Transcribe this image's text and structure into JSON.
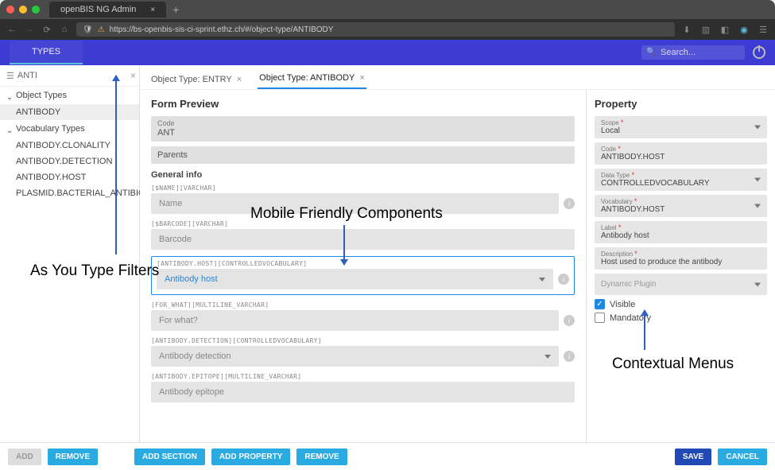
{
  "browser": {
    "tab_title": "openBIS NG Admin",
    "url": "https://bs-openbis-sis-ci-sprint.ethz.ch/#/object-type/ANTIBODY"
  },
  "topbar": {
    "types_label": "TYPES",
    "search_placeholder": "Search..."
  },
  "sidebar": {
    "filter_value": "ANTI",
    "cat_object_types": "Object Types",
    "cat_vocab_types": "Vocabulary Types",
    "items": {
      "antibody": "ANTIBODY",
      "clonality": "ANTIBODY.CLONALITY",
      "detection": "ANTIBODY.DETECTION",
      "host": "ANTIBODY.HOST",
      "plasmid": "PLASMID.BACTERIAL_ANTIBIOTIC_"
    }
  },
  "tabs": {
    "entry": "Object Type: ENTRY",
    "antibody": "Object Type: ANTIBODY"
  },
  "form": {
    "title": "Form Preview",
    "code_label": "Code",
    "code_value": "ANT",
    "parents_label": "Parents",
    "general_info": "General info",
    "meta_name": "[$NAME][VARCHAR]",
    "name_ph": "Name",
    "meta_barcode": "[$BARCODE][VARCHAR]",
    "barcode_ph": "Barcode",
    "meta_host": "[ANTIBODY.HOST][CONTROLLEDVOCABULARY]",
    "host_ph": "Antibody host",
    "meta_forwhat": "[FOR_WHAT][MULTILINE_VARCHAR]",
    "forwhat_ph": "For what?",
    "meta_detection": "[ANTIBODY.DETECTION][CONTROLLEDVOCABULARY]",
    "detection_ph": "Antibody detection",
    "meta_epitope": "[ANTIBODY.EPITOPE][MULTILINE_VARCHAR]",
    "epitope_ph": "Antibody epitope"
  },
  "property": {
    "title": "Property",
    "scope_label": "Scope",
    "scope_value": "Local",
    "code_label": "Code",
    "code_value": "ANTIBODY.HOST",
    "dtype_label": "Data Type",
    "dtype_value": "CONTROLLEDVOCABULARY",
    "vocab_label": "Vocabulary",
    "vocab_value": "ANTIBODY.HOST",
    "label_label": "Label",
    "label_value": "Antibody host",
    "desc_label": "Description",
    "desc_value": "Host used to produce the antibody",
    "plugin_label": "Dynamic Plugin",
    "visible": "Visible",
    "mandatory": "Mandatory"
  },
  "footer": {
    "add": "ADD",
    "remove": "REMOVE",
    "add_section": "ADD SECTION",
    "add_property": "ADD PROPERTY",
    "remove2": "REMOVE",
    "save": "SAVE",
    "cancel": "CANCEL"
  },
  "annotations": {
    "mobile": "Mobile Friendly Components",
    "filters": "As You Type Filters",
    "contextual": "Contextual Menus"
  }
}
